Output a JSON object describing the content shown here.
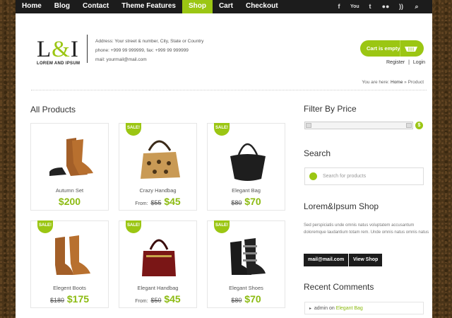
{
  "nav": {
    "items": [
      "Home",
      "Blog",
      "Contact",
      "Theme Features",
      "Shop",
      "Cart",
      "Checkout"
    ],
    "active": "Shop"
  },
  "social_icons": [
    "facebook-icon",
    "youtube-icon",
    "twitter-icon",
    "flickr-icon",
    "rss-icon",
    "search-icon"
  ],
  "header": {
    "logo_mark_1": "L",
    "logo_mark_amp": "&",
    "logo_mark_2": "I",
    "logo_sub": "LOREM AND IPSUM",
    "address": "Address: Your street & number, City, State or Country",
    "phone": "phone: +999 99 999999, fax: +999 99 999999",
    "mail": "mail: yourmail@mail.com",
    "cart_label": "Cart is empty",
    "register": "Register",
    "separator": "|",
    "login": "Login"
  },
  "breadcrumb": {
    "prefix": "You are here:",
    "home": "Home",
    "arrow": "»",
    "current": "Product"
  },
  "main": {
    "title": "All Products"
  },
  "sale_badge": "SALE!",
  "products": [
    {
      "name": "Autumn Set",
      "price": "$200",
      "old_price": "",
      "from": "",
      "sale": false
    },
    {
      "name": "Crazy Handbag",
      "price": "$45",
      "old_price": "$55",
      "from": "From:",
      "sale": true
    },
    {
      "name": "Elegant Bag",
      "price": "$70",
      "old_price": "$80",
      "from": "",
      "sale": true
    },
    {
      "name": "Elegent Boots",
      "price": "$175",
      "old_price": "$180",
      "from": "",
      "sale": true
    },
    {
      "name": "Elegant Handbag",
      "price": "$45",
      "old_price": "$50",
      "from": "From:",
      "sale": true
    },
    {
      "name": "Elegant Shoes",
      "price": "$70",
      "old_price": "$80",
      "from": "",
      "sale": true
    }
  ],
  "sidebar": {
    "filter_title": "Filter By Price",
    "filter_btn": "$",
    "search_title": "Search",
    "search_placeholder": "Search for products",
    "shop_title": "Lorem&Ipsum Shop",
    "shop_text": "Sed perspiciatis unde omnis natus voluptatem accusantum doloremque laudantium totam rem. Unde omnis natus omnis natus",
    "btn_mail": "mail@mail.com",
    "btn_shop": "View Shop",
    "comments_title": "Recent Comments",
    "comment_author": "admin",
    "comment_on": "on",
    "comment_post": "Elegant Bag"
  },
  "colors": {
    "accent": "#9bc613",
    "dark": "#1c1c1c"
  }
}
